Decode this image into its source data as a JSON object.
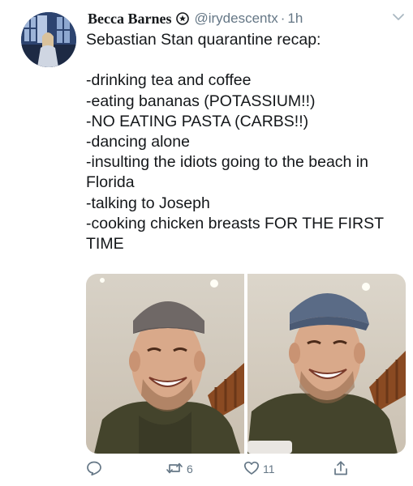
{
  "tweet": {
    "display_name": "Becca Barnes",
    "handle": "@irydescentx",
    "separator": "·",
    "time": "1h",
    "lines": [
      "Sebastian Stan quarantine recap:",
      "",
      "-drinking tea and coffee",
      "-eating bananas (POTASSIUM!!)",
      "-NO EATING PASTA (CARBS!!)",
      "-dancing alone",
      "-insulting the idiots going to the beach in",
      "Florida",
      "-talking to Joseph",
      "-cooking chicken breasts FOR THE FIRST",
      "TIME"
    ]
  },
  "media": {
    "photos": [
      {
        "name": "photo-left",
        "description_icon": "photo"
      },
      {
        "name": "photo-right",
        "description_icon": "photo"
      }
    ]
  },
  "actions": {
    "reply": {
      "icon": "reply-icon",
      "count": ""
    },
    "retweet": {
      "icon": "retweet-icon",
      "count": "6"
    },
    "like": {
      "icon": "heart-icon",
      "count": "11"
    },
    "share": {
      "icon": "share-icon",
      "count": ""
    }
  },
  "colors": {
    "text": "#14171a",
    "secondary": "#657786",
    "background": "#ffffff"
  }
}
